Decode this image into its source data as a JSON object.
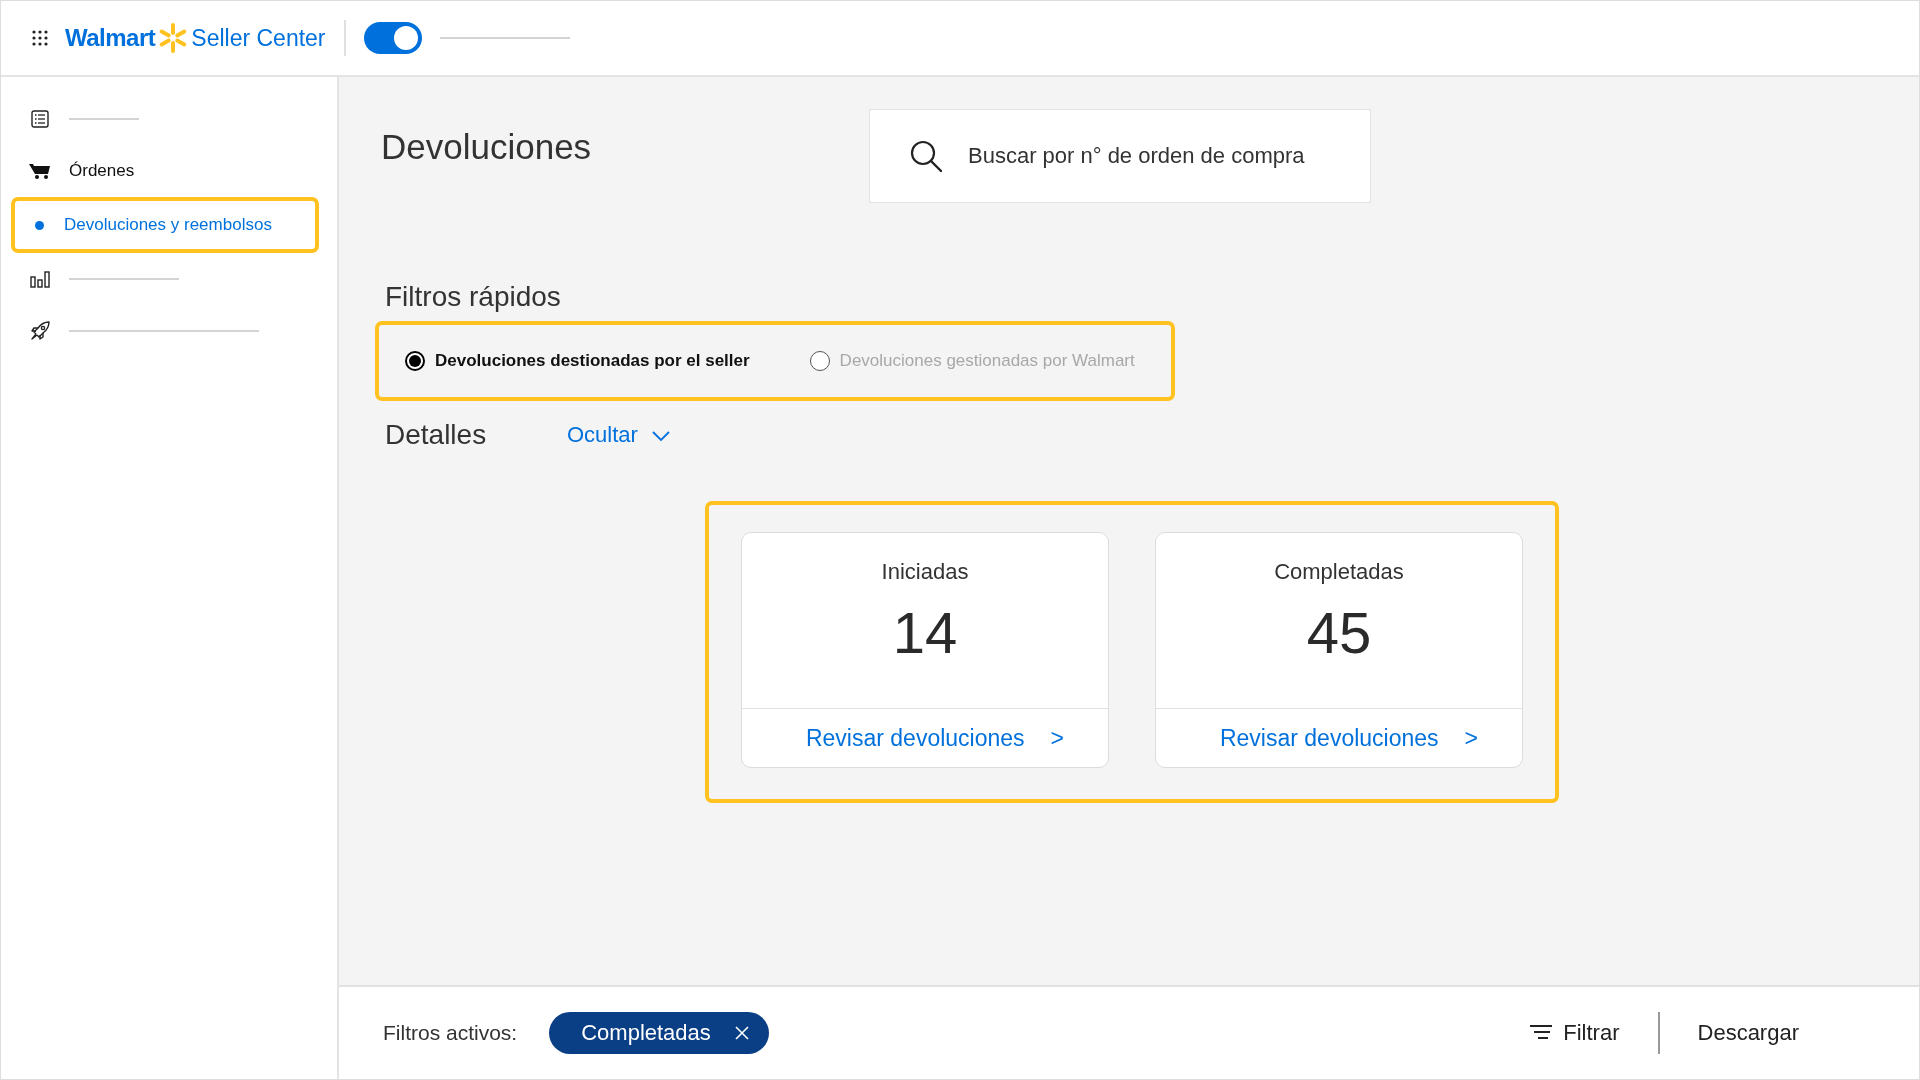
{
  "header": {
    "logo_brand": "Walmart",
    "logo_product": "Seller Center",
    "toggle": {
      "on": true
    }
  },
  "sidebar": {
    "items": [
      {
        "selected": false
      },
      {
        "label": "Órdenes",
        "selected": false,
        "children": [
          {
            "label": "Devoluciones y reembolsos",
            "selected": true
          }
        ]
      },
      {
        "selected": false
      },
      {
        "selected": false
      }
    ]
  },
  "page": {
    "title": "Devoluciones",
    "search": {
      "placeholder": "Buscar por n° de orden de compra"
    }
  },
  "quick_filters": {
    "title": "Filtros rápidos",
    "options": [
      {
        "label": "Devoluciones destionadas por el seller",
        "selected": true,
        "disabled": false
      },
      {
        "label": "Devoluciones gestionadas por Walmart",
        "selected": false,
        "disabled": true
      }
    ]
  },
  "details": {
    "title": "Detalles",
    "toggle_label": "Ocultar",
    "expanded": true,
    "cards": [
      {
        "title": "Iniciadas",
        "count": "14",
        "link": "Revisar devoluciones",
        "arrow": ">"
      },
      {
        "title": "Completadas",
        "count": "45",
        "link": "Revisar devoluciones",
        "arrow": ">"
      }
    ]
  },
  "footer": {
    "label": "Filtros activos:",
    "chips": [
      {
        "label": "Completadas"
      }
    ],
    "filter_button": "Filtrar",
    "download_button": "Descargar"
  }
}
